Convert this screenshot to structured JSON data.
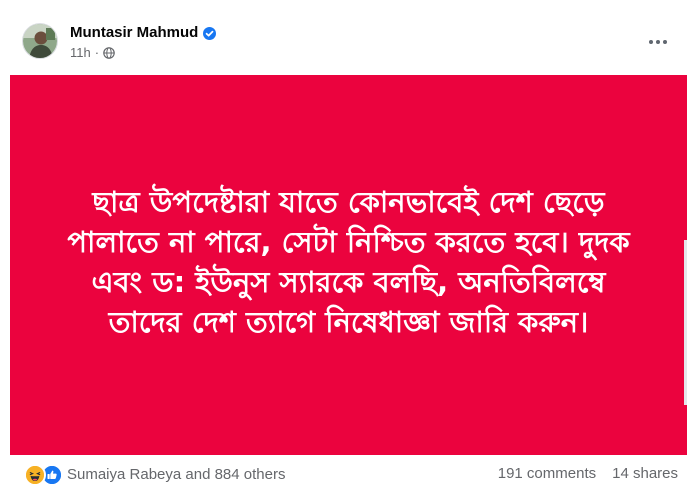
{
  "post": {
    "author": "Muntasir Mahmud",
    "verified_icon": "verified-badge-icon",
    "time": "11h",
    "separator": "·",
    "audience_icon": "globe-icon",
    "more_icon": "more-options-icon",
    "banner_text": "ছাত্র উপদেষ্টারা যাতে কোনভাবেই দেশ ছেড়ে পালাতে না পারে, সেটা নিশ্চিত করতে হবে। দুদক এবং ড: ইউনুস স্যারকে বলছি, অনতিবিলম্বে তাদের দেশ ত্যাগে নিষেধাজ্ঞা জারি করুন।",
    "banner_color": "#eb033e"
  },
  "footer": {
    "reaction_icons": [
      "haha-reaction-icon",
      "like-reaction-icon"
    ],
    "reaction_names": "Sumaiya Rabeya and 884 others",
    "comments": "191 comments",
    "shares": "14 shares"
  },
  "colors": {
    "verified": "#1877f2",
    "meta_text": "#65676b",
    "name_text": "#050505"
  }
}
